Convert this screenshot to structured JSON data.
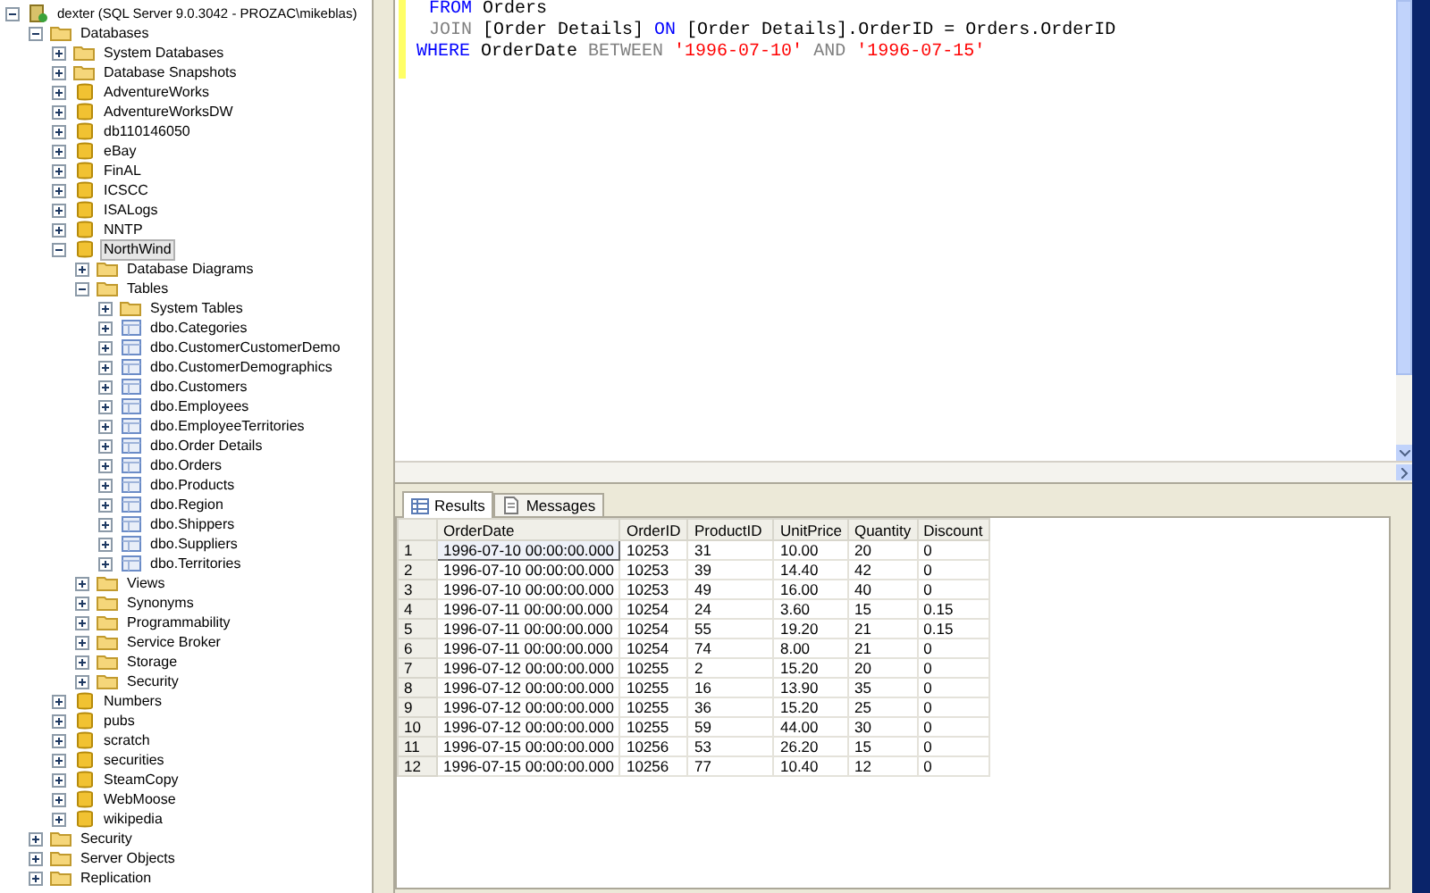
{
  "object_explorer": {
    "tree": [
      {
        "label": "dexter (SQL Server 9.0.3042 - PROZAC\\mikeblas)",
        "kind": "server",
        "expanded": true,
        "selected": false,
        "children": [
          {
            "label": "Databases",
            "kind": "folder",
            "expanded": true,
            "selected": false,
            "children": [
              {
                "label": "System Databases",
                "kind": "folder",
                "expanded": false,
                "selected": false
              },
              {
                "label": "Database Snapshots",
                "kind": "folder",
                "expanded": false,
                "selected": false
              },
              {
                "label": "AdventureWorks",
                "kind": "database",
                "expanded": false,
                "selected": false
              },
              {
                "label": "AdventureWorksDW",
                "kind": "database",
                "expanded": false,
                "selected": false
              },
              {
                "label": "db110146050",
                "kind": "database",
                "expanded": false,
                "selected": false
              },
              {
                "label": "eBay",
                "kind": "database",
                "expanded": false,
                "selected": false
              },
              {
                "label": "FinAL",
                "kind": "database",
                "expanded": false,
                "selected": false
              },
              {
                "label": "ICSCC",
                "kind": "database",
                "expanded": false,
                "selected": false
              },
              {
                "label": "ISALogs",
                "kind": "database",
                "expanded": false,
                "selected": false
              },
              {
                "label": "NNTP",
                "kind": "database",
                "expanded": false,
                "selected": false
              },
              {
                "label": "NorthWind",
                "kind": "database",
                "expanded": true,
                "selected": true,
                "children": [
                  {
                    "label": "Database Diagrams",
                    "kind": "folder",
                    "expanded": false,
                    "selected": false
                  },
                  {
                    "label": "Tables",
                    "kind": "folder",
                    "expanded": true,
                    "selected": false,
                    "children": [
                      {
                        "label": "System Tables",
                        "kind": "folder",
                        "expanded": false,
                        "selected": false
                      },
                      {
                        "label": "dbo.Categories",
                        "kind": "table",
                        "expanded": false,
                        "selected": false
                      },
                      {
                        "label": "dbo.CustomerCustomerDemo",
                        "kind": "table",
                        "expanded": false,
                        "selected": false
                      },
                      {
                        "label": "dbo.CustomerDemographics",
                        "kind": "table",
                        "expanded": false,
                        "selected": false
                      },
                      {
                        "label": "dbo.Customers",
                        "kind": "table",
                        "expanded": false,
                        "selected": false
                      },
                      {
                        "label": "dbo.Employees",
                        "kind": "table",
                        "expanded": false,
                        "selected": false
                      },
                      {
                        "label": "dbo.EmployeeTerritories",
                        "kind": "table",
                        "expanded": false,
                        "selected": false
                      },
                      {
                        "label": "dbo.Order Details",
                        "kind": "table",
                        "expanded": false,
                        "selected": false
                      },
                      {
                        "label": "dbo.Orders",
                        "kind": "table",
                        "expanded": false,
                        "selected": false
                      },
                      {
                        "label": "dbo.Products",
                        "kind": "table",
                        "expanded": false,
                        "selected": false
                      },
                      {
                        "label": "dbo.Region",
                        "kind": "table",
                        "expanded": false,
                        "selected": false
                      },
                      {
                        "label": "dbo.Shippers",
                        "kind": "table",
                        "expanded": false,
                        "selected": false
                      },
                      {
                        "label": "dbo.Suppliers",
                        "kind": "table",
                        "expanded": false,
                        "selected": false
                      },
                      {
                        "label": "dbo.Territories",
                        "kind": "table",
                        "expanded": false,
                        "selected": false
                      }
                    ]
                  },
                  {
                    "label": "Views",
                    "kind": "folder",
                    "expanded": false,
                    "selected": false
                  },
                  {
                    "label": "Synonyms",
                    "kind": "folder",
                    "expanded": false,
                    "selected": false
                  },
                  {
                    "label": "Programmability",
                    "kind": "folder",
                    "expanded": false,
                    "selected": false
                  },
                  {
                    "label": "Service Broker",
                    "kind": "folder",
                    "expanded": false,
                    "selected": false
                  },
                  {
                    "label": "Storage",
                    "kind": "folder",
                    "expanded": false,
                    "selected": false
                  },
                  {
                    "label": "Security",
                    "kind": "folder",
                    "expanded": false,
                    "selected": false
                  }
                ]
              },
              {
                "label": "Numbers",
                "kind": "database",
                "expanded": false,
                "selected": false
              },
              {
                "label": "pubs",
                "kind": "database",
                "expanded": false,
                "selected": false
              },
              {
                "label": "scratch",
                "kind": "database",
                "expanded": false,
                "selected": false
              },
              {
                "label": "securities",
                "kind": "database",
                "expanded": false,
                "selected": false
              },
              {
                "label": "SteamCopy",
                "kind": "database",
                "expanded": false,
                "selected": false
              },
              {
                "label": "WebMoose",
                "kind": "database",
                "expanded": false,
                "selected": false
              },
              {
                "label": "wikipedia",
                "kind": "database",
                "expanded": false,
                "selected": false
              }
            ]
          },
          {
            "label": "Security",
            "kind": "folder",
            "expanded": false,
            "selected": false
          },
          {
            "label": "Server Objects",
            "kind": "folder",
            "expanded": false,
            "selected": false
          },
          {
            "label": "Replication",
            "kind": "folder",
            "expanded": false,
            "selected": false
          }
        ]
      }
    ]
  },
  "editor": {
    "lines": [
      {
        "indent": true,
        "tokens": [
          {
            "text": "FROM",
            "kind": "keyword"
          },
          {
            "text": "Orders",
            "kind": "identifier"
          }
        ]
      },
      {
        "indent": true,
        "tokens": [
          {
            "text": "JOIN",
            "kind": "operator"
          },
          {
            "text": "[Order Details]",
            "kind": "identifier"
          },
          {
            "text": "ON",
            "kind": "keyword"
          },
          {
            "text": "[Order Details].OrderID = Orders.OrderID",
            "kind": "identifier"
          }
        ]
      },
      {
        "indent": false,
        "tokens": [
          {
            "text": "WHERE",
            "kind": "keyword"
          },
          {
            "text": "OrderDate",
            "kind": "identifier"
          },
          {
            "text": "BETWEEN",
            "kind": "operator"
          },
          {
            "text": "'1996-07-10'",
            "kind": "string"
          },
          {
            "text": "AND",
            "kind": "operator"
          },
          {
            "text": "'1996-07-15'",
            "kind": "string"
          }
        ]
      }
    ]
  },
  "results": {
    "tabs": [
      {
        "label": "Results",
        "selected": true
      },
      {
        "label": "Messages",
        "selected": false
      }
    ],
    "columns": [
      "OrderDate",
      "OrderID",
      "ProductID",
      "UnitPrice",
      "Quantity",
      "Discount"
    ],
    "rows": [
      {
        "number": "1",
        "focused": true,
        "cells": [
          "1996-07-10 00:00:00.000",
          "10253",
          "31",
          "10.00",
          "20",
          "0"
        ]
      },
      {
        "number": "2",
        "focused": false,
        "cells": [
          "1996-07-10 00:00:00.000",
          "10253",
          "39",
          "14.40",
          "42",
          "0"
        ]
      },
      {
        "number": "3",
        "focused": false,
        "cells": [
          "1996-07-10 00:00:00.000",
          "10253",
          "49",
          "16.00",
          "40",
          "0"
        ]
      },
      {
        "number": "4",
        "focused": false,
        "cells": [
          "1996-07-11 00:00:00.000",
          "10254",
          "24",
          "3.60",
          "15",
          "0.15"
        ]
      },
      {
        "number": "5",
        "focused": false,
        "cells": [
          "1996-07-11 00:00:00.000",
          "10254",
          "55",
          "19.20",
          "21",
          "0.15"
        ]
      },
      {
        "number": "6",
        "focused": false,
        "cells": [
          "1996-07-11 00:00:00.000",
          "10254",
          "74",
          "8.00",
          "21",
          "0"
        ]
      },
      {
        "number": "7",
        "focused": false,
        "cells": [
          "1996-07-12 00:00:00.000",
          "10255",
          "2",
          "15.20",
          "20",
          "0"
        ]
      },
      {
        "number": "8",
        "focused": false,
        "cells": [
          "1996-07-12 00:00:00.000",
          "10255",
          "16",
          "13.90",
          "35",
          "0"
        ]
      },
      {
        "number": "9",
        "focused": false,
        "cells": [
          "1996-07-12 00:00:00.000",
          "10255",
          "36",
          "15.20",
          "25",
          "0"
        ]
      },
      {
        "number": "10",
        "focused": false,
        "cells": [
          "1996-07-12 00:00:00.000",
          "10255",
          "59",
          "44.00",
          "30",
          "0"
        ]
      },
      {
        "number": "11",
        "focused": false,
        "cells": [
          "1996-07-15 00:00:00.000",
          "10256",
          "53",
          "26.20",
          "15",
          "0"
        ]
      },
      {
        "number": "12",
        "focused": false,
        "cells": [
          "1996-07-15 00:00:00.000",
          "10256",
          "77",
          "10.40",
          "12",
          "0"
        ]
      }
    ]
  }
}
